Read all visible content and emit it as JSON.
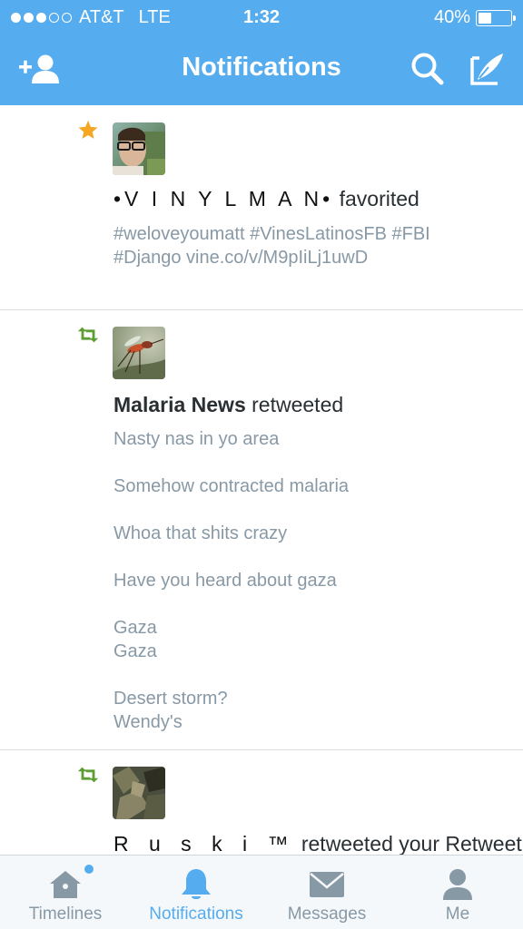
{
  "status_bar": {
    "carrier": "AT&T",
    "network": "LTE",
    "time": "1:32",
    "battery_percent": "40%",
    "battery_level": 0.4,
    "signal_bars": 3
  },
  "nav": {
    "title": "Notifications",
    "left_icon": "add-user-icon",
    "right_icons": [
      "search-icon",
      "compose-icon"
    ]
  },
  "notifications": [
    {
      "type": "favorite",
      "icon": "star-icon",
      "user": "•V I N Y L  M A N•",
      "action": " favorited",
      "text": [
        "#weloveyoumatt #VinesLatinosFB #FBI",
        "#Django vine.co/v/M9pIiLj1uwD"
      ]
    },
    {
      "type": "retweet",
      "icon": "retweet-icon",
      "user": "Malaria News",
      "action": " retweeted",
      "lines": [
        "Nasty nas in yo area",
        "",
        "Somehow contracted malaria",
        "",
        "Whoa that shits crazy",
        "",
        "Have you heard about gaza",
        "",
        "Gaza",
        "Gaza",
        "",
        "Desert storm?",
        "Wendy's"
      ]
    },
    {
      "type": "retweet",
      "icon": "retweet-icon",
      "user": "R u s k i ™",
      "action": " retweeted your Retweet"
    }
  ],
  "tabs": [
    {
      "label": "Timelines",
      "icon": "home-icon",
      "active": false,
      "has_badge": true
    },
    {
      "label": "Notifications",
      "icon": "bell-icon",
      "active": true,
      "has_badge": false
    },
    {
      "label": "Messages",
      "icon": "envelope-icon",
      "active": false,
      "has_badge": false
    },
    {
      "label": "Me",
      "icon": "person-icon",
      "active": false,
      "has_badge": false
    }
  ],
  "colors": {
    "brand": "#55acee",
    "favorite": "#f5a623",
    "retweet": "#5c9e31",
    "muted_text": "#8899a6",
    "dark_text": "#292f33"
  }
}
